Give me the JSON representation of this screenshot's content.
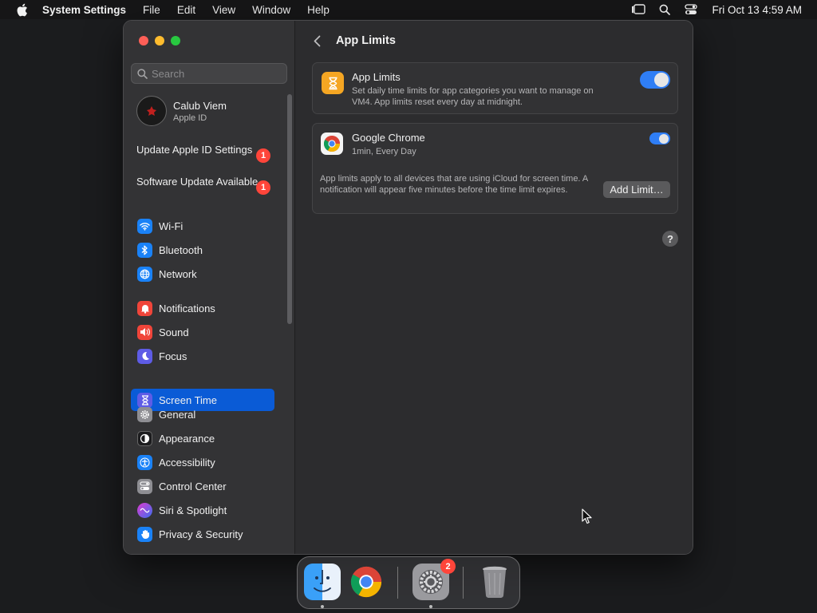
{
  "menubar": {
    "app_name": "System Settings",
    "menus": [
      "File",
      "Edit",
      "View",
      "Window",
      "Help"
    ],
    "clock": "Fri Oct 13  4:59 AM"
  },
  "sidebar": {
    "search_placeholder": "Search",
    "account": {
      "name": "Calub Viem",
      "subtitle": "Apple ID"
    },
    "alerts": [
      {
        "label": "Update Apple ID Settings",
        "badge": "1"
      },
      {
        "label": "Software Update Available",
        "badge": "1"
      }
    ],
    "items": [
      {
        "label": "Wi-Fi",
        "icon": "wifi-icon",
        "color": "#1a82f7"
      },
      {
        "label": "Bluetooth",
        "icon": "bluetooth-icon",
        "color": "#1a82f7"
      },
      {
        "label": "Network",
        "icon": "globe-icon",
        "color": "#1a82f7"
      },
      {
        "label": "Notifications",
        "icon": "bell-icon",
        "color": "#f0453a"
      },
      {
        "label": "Sound",
        "icon": "speaker-icon",
        "color": "#f0453a"
      },
      {
        "label": "Focus",
        "icon": "moon-icon",
        "color": "#5e5ce6"
      },
      {
        "label": "Screen Time",
        "icon": "hourglass-icon",
        "color": "#5e5ce6",
        "selected": true
      },
      {
        "label": "General",
        "icon": "gear-icon",
        "color": "#8e8e93"
      },
      {
        "label": "Appearance",
        "icon": "appearance-icon",
        "color": "#1c1c1e"
      },
      {
        "label": "Accessibility",
        "icon": "accessibility-icon",
        "color": "#1a82f7"
      },
      {
        "label": "Control Center",
        "icon": "control-center-icon",
        "color": "#8e8e93"
      },
      {
        "label": "Siri & Spotlight",
        "icon": "siri-icon",
        "color": "#c03cdc"
      },
      {
        "label": "Privacy & Security",
        "icon": "hand-icon",
        "color": "#1a82f7"
      }
    ]
  },
  "content": {
    "title": "App Limits",
    "app_limits_card": {
      "title": "App Limits",
      "description_line1": "Set daily time limits for app categories you want to manage on",
      "description_line2": "VM4. App limits reset every day at midnight.",
      "enabled": true
    },
    "chrome_card": {
      "app_name": "Google Chrome",
      "limit": "1min, Every Day",
      "enabled": true,
      "footnote": "App limits apply to all devices that are using iCloud for screen time. A notification will appear five minutes before the time limit expires.",
      "add_button": "Add Limit…"
    },
    "help": "?"
  },
  "dock": {
    "settings_badge": "2"
  },
  "colors": {
    "accent": "#2f7ef5",
    "selection": "#0a5bd6",
    "badge": "#ff453a"
  }
}
